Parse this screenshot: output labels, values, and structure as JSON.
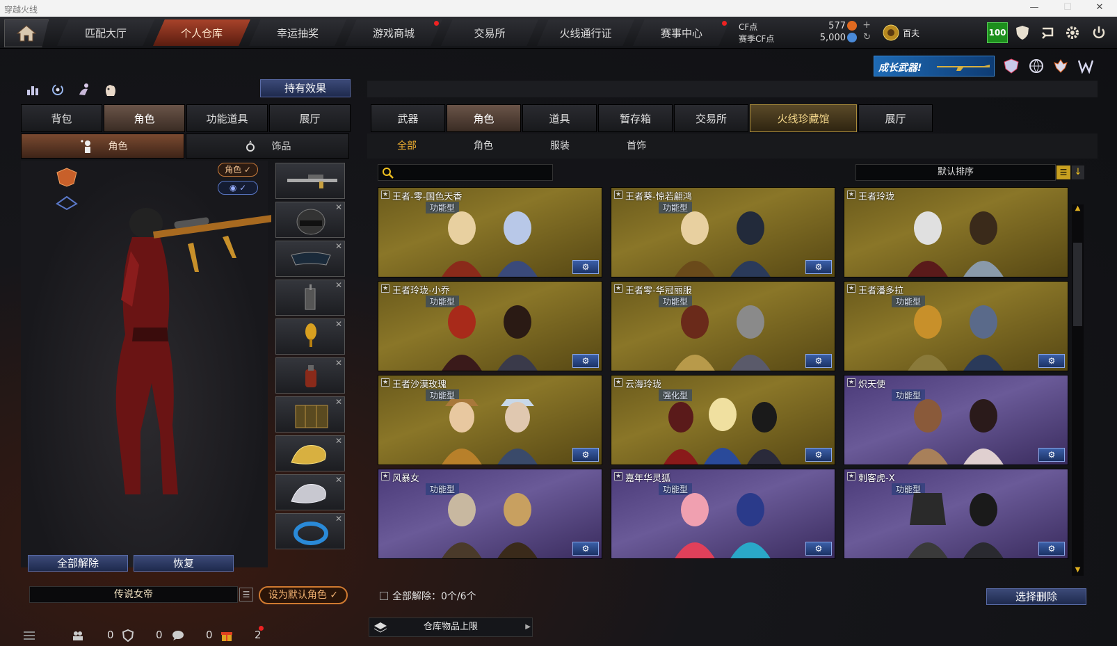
{
  "window": {
    "title": "穿越火线"
  },
  "topnav": {
    "tabs": [
      "匹配大厅",
      "个人仓库",
      "幸运抽奖",
      "游戏商城",
      "交易所",
      "火线通行证",
      "赛事中心"
    ],
    "cf_label": "CF点",
    "season_cf_label": "赛季CF点",
    "cf_value": "577",
    "season_cf_value": "5,000",
    "rank_label": "百夫",
    "level": "100"
  },
  "banner": {
    "growth_text": "成长武器!"
  },
  "left": {
    "effect_button": "持有效果",
    "tabs": [
      "背包",
      "角色",
      "功能道具",
      "展厅"
    ],
    "subtabs": [
      "角色",
      "饰品"
    ],
    "role_toggle": "角色 ✓",
    "eye_toggle": "✓",
    "unequip_all": "全部解除",
    "restore": "恢复",
    "preset_name": "传说女帝",
    "set_default": "设为默认角色 ✓"
  },
  "right": {
    "tabs": [
      "武器",
      "角色",
      "道具",
      "暂存箱",
      "交易所",
      "火线珍藏馆",
      "展厅"
    ],
    "subtabs": [
      "全部",
      "角色",
      "服装",
      "首饰"
    ],
    "sort_label": "默认排序",
    "cards": [
      {
        "name": "王者-零-国色天香",
        "type": "功能型",
        "style": "gold"
      },
      {
        "name": "王者葵-惊若翩鸿",
        "type": "功能型",
        "style": "gold"
      },
      {
        "name": "王者玲珑",
        "type": "",
        "style": "gold"
      },
      {
        "name": "王者玲珑-小乔",
        "type": "功能型",
        "style": "gold"
      },
      {
        "name": "王者零-华冠丽服",
        "type": "功能型",
        "style": "gold"
      },
      {
        "name": "王者潘多拉",
        "type": "功能型",
        "style": "gold"
      },
      {
        "name": "王者沙漠玫瑰",
        "type": "功能型",
        "style": "gold"
      },
      {
        "name": "云海玲珑",
        "type": "强化型",
        "style": "gold"
      },
      {
        "name": "炽天使",
        "type": "功能型",
        "style": "purple"
      },
      {
        "name": "风暴女",
        "type": "功能型",
        "style": "purple"
      },
      {
        "name": "嘉年华灵狐",
        "type": "功能型",
        "style": "purple"
      },
      {
        "name": "刺客虎-X",
        "type": "功能型",
        "style": "purple"
      }
    ],
    "unequip_status": "全部解除：0个/6个",
    "select_delete": "选择删除",
    "capacity_label": "仓库物品上限"
  },
  "bottombar": {
    "count1": "0",
    "count2": "0",
    "count3": "0",
    "count4": "2"
  },
  "colors": {
    "accent_orange": "#d07a30",
    "gold_card": "#8a7628",
    "purple_card": "#6a5a98",
    "button_blue": "#2e3c6a"
  }
}
